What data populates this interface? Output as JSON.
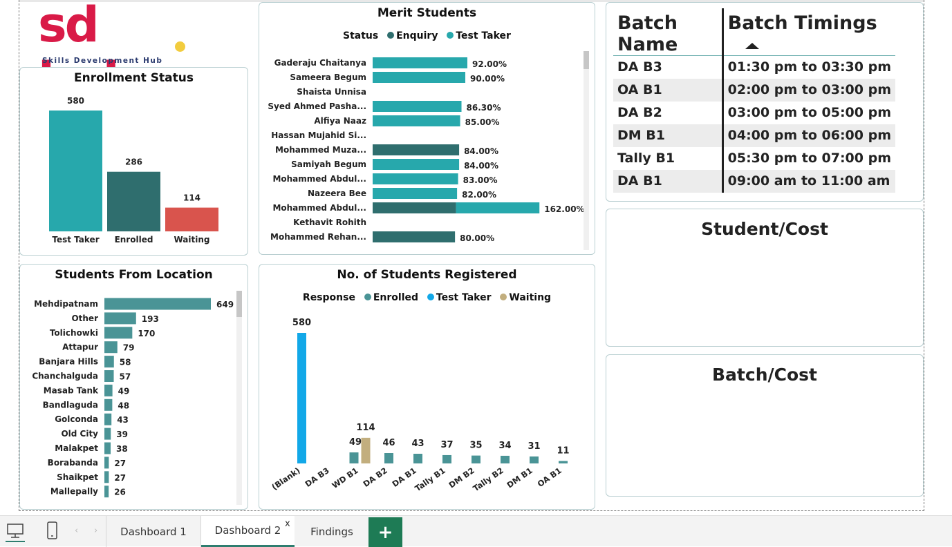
{
  "logo": {
    "main": "sd hub",
    "subtitle": "Skills Development Hub"
  },
  "enrollment_status": {
    "title": "Enrollment Status",
    "chart_data": {
      "type": "bar",
      "categories": [
        "Test Taker",
        "Enrolled",
        "Waiting"
      ],
      "values": [
        580,
        286,
        114
      ],
      "colors": [
        "#27a8ac",
        "#2f6e6e",
        "#d9544d"
      ]
    }
  },
  "merit_students": {
    "title": "Merit Students",
    "legend": {
      "label": "Status",
      "items": [
        {
          "name": "Enquiry",
          "color": "#2f6e6e"
        },
        {
          "name": "Test Taker",
          "color": "#27a8ac"
        }
      ]
    },
    "chart_data": {
      "type": "bar",
      "orientation": "horizontal",
      "stacked": true,
      "rows": [
        {
          "name": "Gaderaju Chaitanya",
          "enquiry": 0,
          "test_taker": 92,
          "label": "92.00%"
        },
        {
          "name": "Sameera Begum",
          "enquiry": 0,
          "test_taker": 90,
          "label": "90.00%"
        },
        {
          "name": "Shaista Unnisa",
          "enquiry": 0,
          "test_taker": 0,
          "label": ""
        },
        {
          "name": "Syed Ahmed Pasha...",
          "enquiry": 0,
          "test_taker": 86.3,
          "label": "86.30%"
        },
        {
          "name": "Alfiya Naaz",
          "enquiry": 0,
          "test_taker": 85,
          "label": "85.00%"
        },
        {
          "name": "Hassan Mujahid Si...",
          "enquiry": 0,
          "test_taker": 0,
          "label": ""
        },
        {
          "name": "Mohammed Muza...",
          "enquiry": 84,
          "test_taker": 0,
          "label": "84.00%"
        },
        {
          "name": "Samiyah Begum",
          "enquiry": 0,
          "test_taker": 84,
          "label": "84.00%"
        },
        {
          "name": "Mohammed Abdul...",
          "enquiry": 0,
          "test_taker": 83,
          "label": "83.00%"
        },
        {
          "name": "Nazeera Bee",
          "enquiry": 0,
          "test_taker": 82,
          "label": "82.00%"
        },
        {
          "name": "Mohammed Abdul...",
          "enquiry": 81,
          "test_taker": 81,
          "label": "162.00%"
        },
        {
          "name": "Kethavit Rohith",
          "enquiry": 0,
          "test_taker": 0,
          "label": ""
        },
        {
          "name": "Mohammed Rehan...",
          "enquiry": 80,
          "test_taker": 0,
          "label": "80.00%"
        }
      ]
    }
  },
  "batch_table": {
    "headers": [
      "Batch Name",
      "Batch Timings"
    ],
    "rows": [
      [
        "DA B3",
        "01:30 pm to 03:30 pm"
      ],
      [
        "OA B1",
        "02:00 pm to 03:00 pm"
      ],
      [
        "DA B2",
        "03:00 pm to 05:00 pm"
      ],
      [
        "DM B1",
        "04:00 pm to 06:00 pm"
      ],
      [
        "Tally B1",
        "05:30 pm to 07:00 pm"
      ],
      [
        "DA B1",
        "09:00 am to 11:00 am"
      ]
    ]
  },
  "student_cost": {
    "title": "Student/Cost"
  },
  "batch_cost": {
    "title": "Batch/Cost"
  },
  "students_location": {
    "title": "Students From Location",
    "chart_data": {
      "type": "bar",
      "orientation": "horizontal",
      "color": "#4a9496",
      "categories": [
        "Mehdipatnam",
        "Other",
        "Tolichowki",
        "Attapur",
        "Banjara Hills",
        "Chanchalguda",
        "Masab Tank",
        "Bandlaguda",
        "Golconda",
        "Old City",
        "Malakpet",
        "Borabanda",
        "Shaikpet",
        "Mallepally"
      ],
      "values": [
        649,
        193,
        170,
        79,
        58,
        57,
        49,
        48,
        43,
        39,
        38,
        27,
        27,
        26
      ]
    }
  },
  "students_registered": {
    "title": "No. of Students Registered",
    "legend": {
      "label": "Response",
      "items": [
        {
          "name": "Enrolled",
          "color": "#4a9496"
        },
        {
          "name": "Test Taker",
          "color": "#12a8e8"
        },
        {
          "name": "Waiting",
          "color": "#c2ae7e"
        }
      ]
    },
    "chart_data": {
      "type": "bar",
      "categories": [
        "(Blank)",
        "DA B3",
        "WD B1",
        "DA B2",
        "DA B1",
        "Tally B1",
        "DM B2",
        "Tally B2",
        "DM B1",
        "OA B1"
      ],
      "series": [
        {
          "name": "Enrolled",
          "values": [
            0,
            0,
            49,
            46,
            43,
            37,
            35,
            34,
            31,
            11
          ]
        },
        {
          "name": "Test Taker",
          "values": [
            580,
            0,
            0,
            0,
            0,
            0,
            0,
            0,
            0,
            0
          ]
        },
        {
          "name": "Waiting",
          "values": [
            0,
            0,
            114,
            0,
            0,
            0,
            0,
            0,
            0,
            0
          ]
        }
      ]
    }
  },
  "tabs": [
    {
      "label": "Dashboard 1",
      "active": false
    },
    {
      "label": "Dashboard 2",
      "active": true
    },
    {
      "label": "Findings",
      "active": false
    }
  ],
  "tab_close": "x",
  "add_tab": "+"
}
